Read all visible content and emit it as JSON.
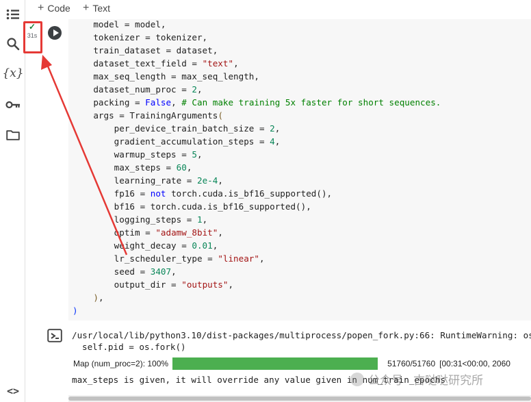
{
  "toolbar": {
    "add_code_label": "Code",
    "add_text_label": "Text"
  },
  "sidebar": {
    "items": [
      {
        "icon": "table-of-contents-icon"
      },
      {
        "icon": "search-icon"
      },
      {
        "icon": "variables-icon",
        "label": "{x}"
      },
      {
        "icon": "key-icon"
      },
      {
        "icon": "folder-icon"
      }
    ],
    "bottom_icon": {
      "icon": "code-brackets-icon",
      "label": "<>"
    }
  },
  "cell": {
    "status": {
      "check": "✓",
      "duration": "31s"
    },
    "code_lines": [
      [
        {
          "t": "    model = model,"
        }
      ],
      [
        {
          "t": "    tokenizer = tokenizer,"
        }
      ],
      [
        {
          "t": "    train_dataset = dataset,"
        }
      ],
      [
        {
          "t": "    dataset_text_field = "
        },
        {
          "t": "\"text\"",
          "c": "str"
        },
        {
          "t": ","
        }
      ],
      [
        {
          "t": "    max_seq_length = max_seq_length,"
        }
      ],
      [
        {
          "t": "    dataset_num_proc = "
        },
        {
          "t": "2",
          "c": "num"
        },
        {
          "t": ","
        }
      ],
      [
        {
          "t": "    packing = "
        },
        {
          "t": "False",
          "c": "kw"
        },
        {
          "t": ", "
        },
        {
          "t": "# Can make training 5x faster for short sequences.",
          "c": "cmt"
        }
      ],
      [
        {
          "t": "    args = TrainingArguments"
        },
        {
          "t": "(",
          "c": "par"
        }
      ],
      [
        {
          "t": "        per_device_train_batch_size = "
        },
        {
          "t": "2",
          "c": "num"
        },
        {
          "t": ","
        }
      ],
      [
        {
          "t": "        gradient_accumulation_steps = "
        },
        {
          "t": "4",
          "c": "num"
        },
        {
          "t": ","
        }
      ],
      [
        {
          "t": "        warmup_steps = "
        },
        {
          "t": "5",
          "c": "num"
        },
        {
          "t": ","
        }
      ],
      [
        {
          "t": "        max_steps = "
        },
        {
          "t": "60",
          "c": "num"
        },
        {
          "t": ","
        }
      ],
      [
        {
          "t": "        learning_rate = "
        },
        {
          "t": "2e-4",
          "c": "num"
        },
        {
          "t": ","
        }
      ],
      [
        {
          "t": "        fp16 = "
        },
        {
          "t": "not",
          "c": "kw"
        },
        {
          "t": " torch.cuda.is_bf16_supported(),"
        }
      ],
      [
        {
          "t": "        bf16 = torch.cuda.is_bf16_supported(),"
        }
      ],
      [
        {
          "t": "        logging_steps = "
        },
        {
          "t": "1",
          "c": "num"
        },
        {
          "t": ","
        }
      ],
      [
        {
          "t": "        optim = "
        },
        {
          "t": "\"adamw_8bit\"",
          "c": "str"
        },
        {
          "t": ","
        }
      ],
      [
        {
          "t": "        weight_decay = "
        },
        {
          "t": "0.01",
          "c": "num"
        },
        {
          "t": ","
        }
      ],
      [
        {
          "t": "        lr_scheduler_type = "
        },
        {
          "t": "\"linear\"",
          "c": "str"
        },
        {
          "t": ","
        }
      ],
      [
        {
          "t": "        seed = "
        },
        {
          "t": "3407",
          "c": "num"
        },
        {
          "t": ","
        }
      ],
      [
        {
          "t": "        output_dir = "
        },
        {
          "t": "\"outputs\"",
          "c": "str"
        },
        {
          "t": ","
        }
      ],
      [
        {
          "t": "    "
        },
        {
          "t": ")",
          "c": "par"
        },
        {
          "t": ","
        }
      ],
      [
        {
          "t": ")",
          "c": "pb"
        }
      ]
    ]
  },
  "output": {
    "warning_line1": "/usr/local/lib/python3.10/dist-packages/multiprocess/popen_fork.py:66: RuntimeWarning: os.",
    "warning_line2": "self.pid = os.fork()",
    "progress": {
      "label": "Map (num_proc=2): 100%",
      "fraction": 1.0,
      "count": "51760/51760",
      "timing": "[00:31<00:00, 2060"
    },
    "message": "max_steps is given, it will override any value given in num_train_epochs"
  },
  "watermark": {
    "text": "公众号 · 古哒哒研究所"
  },
  "colors": {
    "accent_green": "#4caf50",
    "highlight_red": "#e53935",
    "check_green": "#188038"
  }
}
